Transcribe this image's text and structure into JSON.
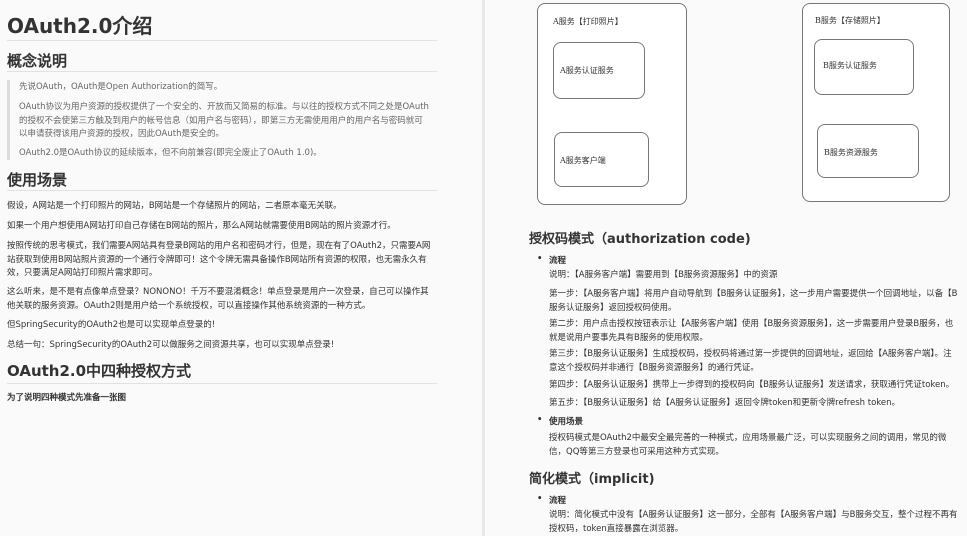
{
  "left": {
    "title": "OAuth2.0介绍",
    "concept": {
      "heading": "概念说明",
      "quote": [
        "先说OAuth，OAuth是Open Authorization的简写。",
        "OAuth协议为用户资源的授权提供了一个安全的、开放而又简易的标准。与以往的授权方式不同之处是OAuth的授权不会使第三方触及到用户的帐号信息（如用户名与密码），即第三方无需使用用户的用户名与密码就可以申请获得该用户资源的授权，因此OAuth是安全的。",
        "OAuth2.0是OAuth协议的延续版本，但不向前兼容(即完全废止了OAuth 1.0)。"
      ]
    },
    "scenario": {
      "heading": "使用场景",
      "paragraphs": [
        "假设，A网站是一个打印照片的网站，B网站是一个存储照片的网站，二者原本毫无关联。",
        "如果一个用户想使用A网站打印自己存储在B网站的照片，那么A网站就需要使用B网站的照片资源才行。",
        "按照传统的思考模式，我们需要A网站具有登录B网站的用户名和密码才行，但是，现在有了OAuth2，只需要A网站获取到使用B网站照片资源的一个通行令牌即可！这个令牌无需具备操作B网站所有资源的权限，也无需永久有效，只要满足A网站打印照片需求即可。",
        "这么听来，是不是有点像单点登录？NONONO！千万不要混淆概念！单点登录是用户一次登录，自己可以操作其他关联的服务资源。OAuth2则是用户给一个系统授权，可以直接操作其他系统资源的一种方式。",
        "但SpringSecurity的OAuth2也是可以实现单点登录的!",
        "总结一句：SpringSecurity的OAuth2可以做服务之间资源共享，也可以实现单点登录!"
      ]
    },
    "four": {
      "heading": "OAuth2.0中四种授权方式",
      "note": "为了说明四种模式先准备一张图"
    }
  },
  "diagram": {
    "a_title": "A服务【打印照片】",
    "a_auth": "A服务认证服务",
    "a_client": "A服务客户端",
    "b_title": "B服务【存储照片】",
    "b_auth": "B服务认证服务",
    "b_resource": "B服务资源服务"
  },
  "right": {
    "auth_code": {
      "heading": "授权码模式（authorization code)",
      "flow_label": "流程",
      "steps": [
        "说明：【A服务客户端】需要用到【B服务资源服务】中的资源",
        "第一步：【A服务客户端】将用户自动导航到【B服务认证服务】，这一步用户需要提供一个回调地址，以备【B服务认证服务】返回授权码使用。",
        "第二步：用户点击授权按钮表示让【A服务客户端】使用【B服务资源服务】，这一步需要用户登录B服务，也就是说用户要事先具有B服务的使用权限。",
        "第三步：【B服务认证服务】生成授权码，授权码将通过第一步提供的回调地址，返回给【A服务客户端】。注意这个授权码并非通行【B服务资源服务】的通行凭证。",
        "第四步：【A服务认证服务】携带上一步得到的授权码向【B服务认证服务】发送请求，获取通行凭证token。",
        "第五步：【B服务认证服务】给【A服务认证服务】返回令牌token和更新令牌refresh token。"
      ],
      "usage_label": "使用场景",
      "usage": "授权码模式是OAuth2中最安全最完善的一种模式，应用场景最广泛，可以实现服务之间的调用，常见的微信，QQ等第三方登录也可采用这种方式实现。"
    },
    "implicit": {
      "heading": "简化模式（implicit)",
      "flow_label": "流程",
      "desc": "说明：简化模式中没有【A服务认证服务】这一部分，全部有【A服务客户端】与B服务交互，整个过程不再有授权码，token直接暴露在浏览器。"
    }
  }
}
